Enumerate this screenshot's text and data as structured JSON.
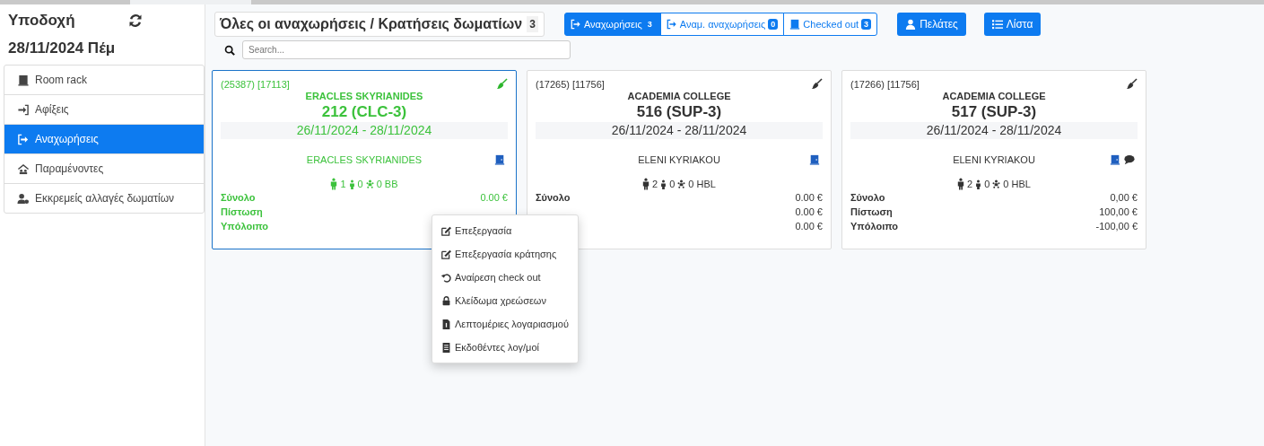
{
  "sidebar": {
    "title": "Υποδοχή",
    "date": "28/11/2024 Πέμ",
    "items": [
      {
        "label": "Room rack",
        "selected": false
      },
      {
        "label": "Αφίξεις",
        "selected": false
      },
      {
        "label": "Αναχωρήσεις",
        "selected": true
      },
      {
        "label": "Παραμένοντες",
        "selected": false
      },
      {
        "label": "Εκκρεμείς αλλαγές δωματίων",
        "selected": false
      }
    ]
  },
  "header": {
    "title": "Όλες οι αναχωρήσεις / Κρατήσεις δωματίων",
    "count": "3"
  },
  "filters": [
    {
      "label": "Αναχωρήσεις",
      "count": "3",
      "selected": true
    },
    {
      "label": "Αναμ. αναχωρήσεις",
      "count": "0",
      "selected": false
    },
    {
      "label": "Checked out",
      "count": "3",
      "selected": false
    }
  ],
  "buttons": [
    "Πελάτες",
    "Λίστα"
  ],
  "search": {
    "placeholder": "Search..."
  },
  "cards": [
    {
      "ids": "(25387) [17113]",
      "company": "ERACLES SKYRIANIDES",
      "room": "212 (CLC-3)",
      "dates": "26/11/2024 - 28/11/2024",
      "guest": "ERACLES SKYRIANIDES",
      "has_note": false,
      "selected": true,
      "adults": "1",
      "children": "0",
      "infants": "0",
      "board": "BB",
      "totals": [
        {
          "label": "Σύνολο",
          "value": "0.00 €"
        },
        {
          "label": "Πίστωση"
        },
        {
          "label": "Υπόλοιπο"
        }
      ]
    },
    {
      "ids": "(17265) [11756]",
      "company": "ACADEMIA COLLEGE",
      "room": "516 (SUP-3)",
      "dates": "26/11/2024 - 28/11/2024",
      "guest": "ELENI KYRIAKOU",
      "has_note": false,
      "selected": false,
      "adults": "2",
      "children": "0",
      "infants": "0",
      "board": "HBL",
      "totals": [
        {
          "label": "Σύνολο",
          "value": "0.00 €"
        },
        {
          "value": "0.00 €"
        },
        {
          "value": "0.00 €"
        }
      ]
    },
    {
      "ids": "(17266) [11756]",
      "company": "ACADEMIA COLLEGE",
      "room": "517 (SUP-3)",
      "dates": "26/11/2024 - 28/11/2024",
      "guest": "ELENI KYRIAKOU",
      "has_note": true,
      "selected": false,
      "adults": "2",
      "children": "0",
      "infants": "0",
      "board": "HBL",
      "totals": [
        {
          "label": "Σύνολο",
          "value": "0,00 €"
        },
        {
          "label": "Πίστωση",
          "value": "100,00 €"
        },
        {
          "label": "Υπόλοιπο",
          "value": "-100,00 €"
        }
      ]
    }
  ],
  "context_menu": [
    "Επεξεργασία",
    "Επεξεργασία κράτησης",
    "Αναίρεση check out",
    "Κλείδωμα χρεώσεων",
    "Λεπτομέριες λογαριασμού",
    "Εκδοθέντες λογ/μοί"
  ]
}
